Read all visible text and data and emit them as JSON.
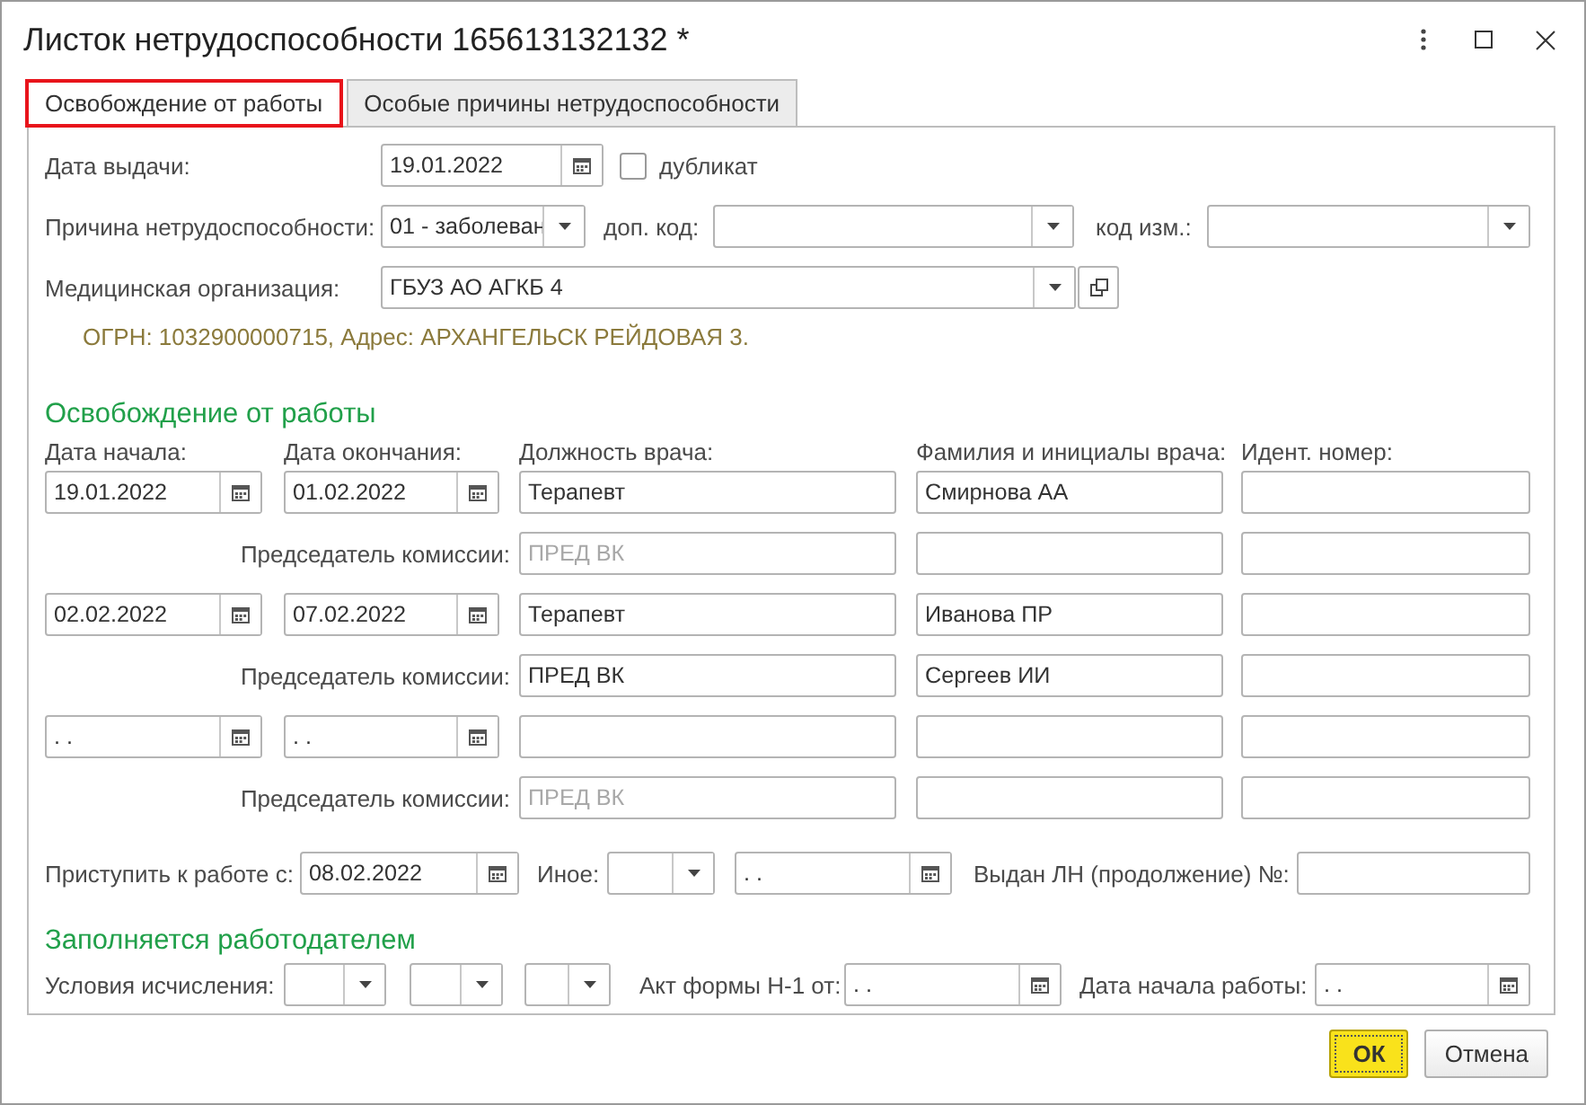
{
  "window": {
    "title": "Листок нетрудоспособности 165613132132 *"
  },
  "tabs": [
    {
      "label": "Освобождение от работы",
      "selected": true,
      "highlighted": true
    },
    {
      "label": "Особые причины нетрудоспособности",
      "selected": false,
      "highlighted": false
    }
  ],
  "header": {
    "issue_date": {
      "label": "Дата выдачи:",
      "value": "19.01.2022"
    },
    "duplicate": {
      "label": "дубликат",
      "checked": false
    },
    "reason": {
      "label": "Причина нетрудоспособности:",
      "value": "01 - заболеван"
    },
    "extra_code": {
      "label": "доп. код:"
    },
    "change_code": {
      "label": "код изм.:"
    },
    "medical_org": {
      "label": "Медицинская организация:",
      "value": "ГБУЗ АО АГКБ 4"
    },
    "org_info": "ОГРН: 1032900000715, Адрес: АРХАНГЕЛЬСК РЕЙДОВАЯ 3."
  },
  "release": {
    "title": "Освобождение от работы",
    "columns": [
      "Дата начала:",
      "Дата окончания:",
      "Должность врача:",
      "Фамилия и инициалы врача:",
      "Идент.  номер:"
    ],
    "periods": [
      {
        "start": "19.01.2022",
        "end": "01.02.2022",
        "doctor_position": "Терапевт",
        "doctor_name": "Смирнова АА",
        "chair_label": "Председатель комиссии:",
        "chair": {
          "placeholder": "ПРЕД ВК"
        }
      },
      {
        "start": "02.02.2022",
        "end": "07.02.2022",
        "doctor_position": "Терапевт",
        "doctor_name": "Иванова ПР",
        "chair_label": "Председатель комиссии:",
        "chair": {
          "value": "ПРЕД ВК"
        },
        "chair_name": "Сергеев ИИ"
      },
      {
        "start": " .  .",
        "end": " .  .",
        "chair_label": "Председатель комиссии:",
        "chair": {
          "placeholder": "ПРЕД ВК"
        }
      }
    ]
  },
  "return_to_work": {
    "label": "Приступить к работе с:",
    "value": "08.02.2022",
    "other_label": "Иное:",
    "other_date": " .  .",
    "continuation_label": "Выдан ЛН (продолжение) №:"
  },
  "employer": {
    "title": "Заполняется работодателем",
    "conditions_label": "Условия исчисления:",
    "act_label": "Акт формы Н-1 от:",
    "act_date": " .  .",
    "start_label": "Дата начала работы:",
    "start_date": " .  ."
  },
  "buttons": [
    {
      "label": "ОК",
      "default": true
    },
    {
      "label": "Отмена",
      "default": false
    }
  ]
}
